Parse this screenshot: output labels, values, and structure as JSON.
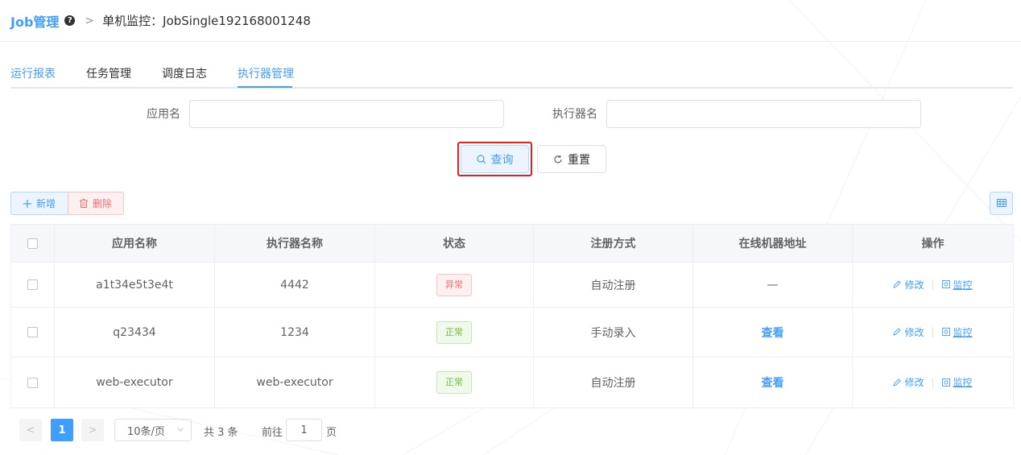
{
  "header": {
    "brand": "Job管理",
    "help_icon": "?",
    "separator": ">",
    "current": "单机监控：JobSingle192168001248"
  },
  "tabs": [
    {
      "label": "运行报表",
      "active": false
    },
    {
      "label": "任务管理",
      "active": false
    },
    {
      "label": "调度日志",
      "active": false
    },
    {
      "label": "执行器管理",
      "active": true
    }
  ],
  "search": {
    "app_label": "应用名",
    "app_value": "",
    "executor_label": "执行器名",
    "executor_value": "",
    "query_button": "查询",
    "reset_button": "重置"
  },
  "toolbar": {
    "add_label": "新增",
    "delete_label": "删除",
    "columns_icon": "table-columns-icon"
  },
  "table": {
    "headers": [
      "应用名称",
      "执行器名称",
      "状态",
      "注册方式",
      "在线机器地址",
      "操作"
    ],
    "rows": [
      {
        "app": "a1t34e5t3e4t",
        "executor": "4442",
        "status": "异常",
        "status_type": "error",
        "register": "自动注册",
        "address": "—",
        "edit": "修改",
        "monitor": "监控"
      },
      {
        "app": "q23434",
        "executor": "1234",
        "status": "正常",
        "status_type": "success",
        "register": "手动录入",
        "address": "查看",
        "edit": "修改",
        "monitor": "监控"
      },
      {
        "app": "web-executor",
        "executor": "web-executor",
        "status": "正常",
        "status_type": "success",
        "register": "自动注册",
        "address": "查看",
        "edit": "修改",
        "monitor": "监控"
      }
    ]
  },
  "pagination": {
    "prev": "<",
    "current_page": "1",
    "next": ">",
    "page_size": "10条/页",
    "total": "共 3 条",
    "goto_label": "前往",
    "goto_value": "1",
    "page_suffix": "页"
  },
  "colors": {
    "primary": "#409eff",
    "danger": "#f56c6c",
    "success": "#67c23a",
    "highlight_border": "#e0201f"
  }
}
